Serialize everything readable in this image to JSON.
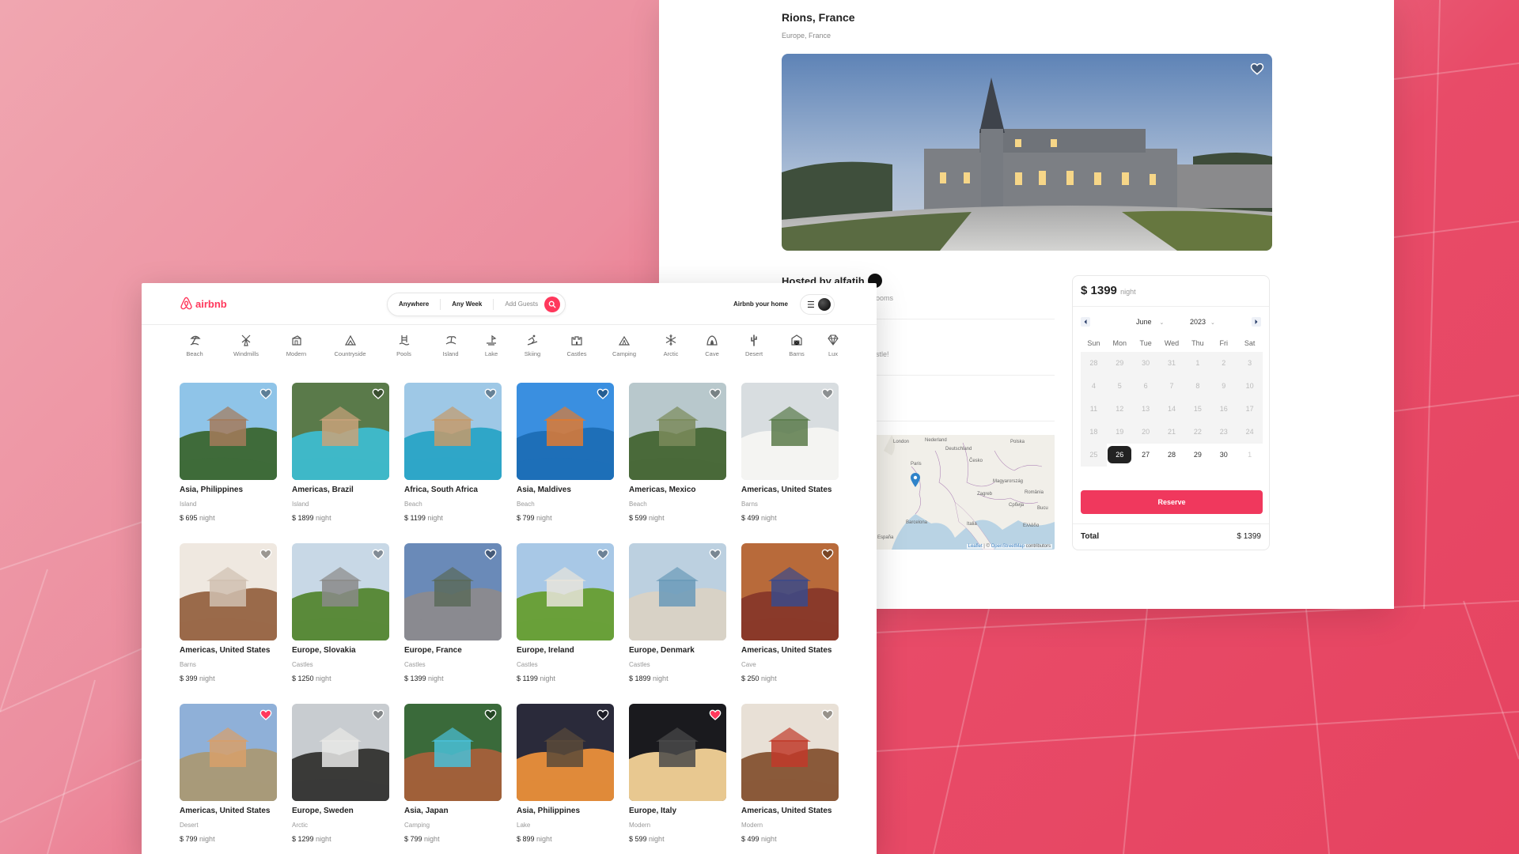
{
  "detail": {
    "title": "Rions, France",
    "subtitle": "Europe, France",
    "hosted_by": "Hosted by alfatih",
    "fragment_rooms": "ooms",
    "fragment_castle": "stle!",
    "map": {
      "labels": [
        "London",
        "Nederland",
        "Deutschland",
        "Paris",
        "Česko",
        "Polska",
        "Magyarország",
        "Zagreb",
        "România",
        "Србија",
        "Barcelona",
        "Italia",
        "Bucu",
        "España",
        "Ελλάδα"
      ],
      "attribution_leaflet": "Leaflet",
      "attribution_sep": " | © ",
      "attribution_osm": "OpenStreetMap",
      "attribution_tail": " contributors"
    },
    "booking": {
      "price": "$ 1399",
      "price_unit": "night",
      "month": "June",
      "year": "2023",
      "weekdays": [
        "Sun",
        "Mon",
        "Tue",
        "Wed",
        "Thu",
        "Fri",
        "Sat"
      ],
      "days": [
        {
          "d": "28",
          "s": "x"
        },
        {
          "d": "29",
          "s": "x"
        },
        {
          "d": "30",
          "s": "x"
        },
        {
          "d": "31",
          "s": "x"
        },
        {
          "d": "1",
          "s": "x"
        },
        {
          "d": "2",
          "s": "x"
        },
        {
          "d": "3",
          "s": "x"
        },
        {
          "d": "4",
          "s": "x"
        },
        {
          "d": "5",
          "s": "x"
        },
        {
          "d": "6",
          "s": "x"
        },
        {
          "d": "7",
          "s": "x"
        },
        {
          "d": "8",
          "s": "x"
        },
        {
          "d": "9",
          "s": "x"
        },
        {
          "d": "10",
          "s": "x"
        },
        {
          "d": "11",
          "s": "x"
        },
        {
          "d": "12",
          "s": "x"
        },
        {
          "d": "13",
          "s": "x"
        },
        {
          "d": "14",
          "s": "x"
        },
        {
          "d": "15",
          "s": "x"
        },
        {
          "d": "16",
          "s": "x"
        },
        {
          "d": "17",
          "s": "x"
        },
        {
          "d": "18",
          "s": "x"
        },
        {
          "d": "19",
          "s": "x"
        },
        {
          "d": "20",
          "s": "x"
        },
        {
          "d": "21",
          "s": "x"
        },
        {
          "d": "22",
          "s": "x"
        },
        {
          "d": "23",
          "s": "x"
        },
        {
          "d": "24",
          "s": "x"
        },
        {
          "d": "25",
          "s": "x"
        },
        {
          "d": "26",
          "s": "sel"
        },
        {
          "d": "27",
          "s": "av"
        },
        {
          "d": "28",
          "s": "av"
        },
        {
          "d": "29",
          "s": "av"
        },
        {
          "d": "30",
          "s": "av"
        },
        {
          "d": "1",
          "s": "w"
        }
      ],
      "reserve_label": "Reserve",
      "total_label": "Total",
      "total_value": "$ 1399"
    }
  },
  "header": {
    "logo_text": "airbnb",
    "search": {
      "anywhere": "Anywhere",
      "week": "Any Week",
      "guests": "Add Guests"
    },
    "host_link": "Airbnb your home"
  },
  "categories": [
    {
      "label": "Beach",
      "icon": "beach-icon"
    },
    {
      "label": "Windmills",
      "icon": "windmill-icon"
    },
    {
      "label": "Modern",
      "icon": "modern-icon"
    },
    {
      "label": "Countryside",
      "icon": "countryside-icon"
    },
    {
      "label": "Pools",
      "icon": "pool-icon"
    },
    {
      "label": "Island",
      "icon": "island-icon"
    },
    {
      "label": "Lake",
      "icon": "lake-icon"
    },
    {
      "label": "Skiing",
      "icon": "skiing-icon"
    },
    {
      "label": "Castles",
      "icon": "castle-icon"
    },
    {
      "label": "Camping",
      "icon": "camping-icon"
    },
    {
      "label": "Arctic",
      "icon": "snowflake-icon"
    },
    {
      "label": "Cave",
      "icon": "cave-icon"
    },
    {
      "label": "Desert",
      "icon": "cactus-icon"
    },
    {
      "label": "Barns",
      "icon": "barn-icon"
    },
    {
      "label": "Lux",
      "icon": "diamond-icon"
    }
  ],
  "listings": [
    {
      "location": "Asia, Philippines",
      "category": "Island",
      "price": "$ 695",
      "unit": "night",
      "fav": false,
      "c1": "#8fc4e8",
      "c2": "#3f6b3a",
      "c3": "#a47a5a"
    },
    {
      "location": "Americas, Brazil",
      "category": "Island",
      "price": "$ 1899",
      "unit": "night",
      "fav": false,
      "c1": "#5a7a4a",
      "c2": "#3fb8c8",
      "c3": "#c9a27a"
    },
    {
      "location": "Africa, South Africa",
      "category": "Beach",
      "price": "$ 1199",
      "unit": "night",
      "fav": false,
      "c1": "#9ec8e6",
      "c2": "#2fa6c8",
      "c3": "#c49a6a"
    },
    {
      "location": "Asia, Maldives",
      "category": "Beach",
      "price": "$ 799",
      "unit": "night",
      "fav": false,
      "c1": "#3a8fe0",
      "c2": "#1e6fb8",
      "c3": "#e07a30"
    },
    {
      "location": "Americas, Mexico",
      "category": "Beach",
      "price": "$ 599",
      "unit": "night",
      "fav": false,
      "c1": "#b8c8cc",
      "c2": "#4a6a3a",
      "c3": "#7a8a5a"
    },
    {
      "location": "Americas, United States",
      "category": "Barns",
      "price": "$ 499",
      "unit": "night",
      "fav": false,
      "c1": "#d8dde0",
      "c2": "#f4f4f2",
      "c3": "#5a7a4a"
    },
    {
      "location": "Americas, United States",
      "category": "Barns",
      "price": "$ 399",
      "unit": "night",
      "fav": false,
      "c1": "#efe8e0",
      "c2": "#9a6a4a",
      "c3": "#d0c0b0"
    },
    {
      "location": "Europe, Slovakia",
      "category": "Castles",
      "price": "$ 1250",
      "unit": "night",
      "fav": false,
      "c1": "#c8d8e6",
      "c2": "#5a8a3a",
      "c3": "#8a8a88"
    },
    {
      "location": "Europe, France",
      "category": "Castles",
      "price": "$ 1399",
      "unit": "night",
      "fav": false,
      "c1": "#6a8ab8",
      "c2": "#8a8a90",
      "c3": "#5a6a5a"
    },
    {
      "location": "Europe, Ireland",
      "category": "Castles",
      "price": "$ 1199",
      "unit": "night",
      "fav": false,
      "c1": "#a8c8e6",
      "c2": "#6aa03a",
      "c3": "#e8e4da"
    },
    {
      "location": "Europe, Denmark",
      "category": "Castles",
      "price": "$ 1899",
      "unit": "night",
      "fav": false,
      "c1": "#bcd0e0",
      "c2": "#d8d2c6",
      "c3": "#6a9ab8"
    },
    {
      "location": "Americas, United States",
      "category": "Cave",
      "price": "$ 250",
      "unit": "night",
      "fav": false,
      "c1": "#b86a3a",
      "c2": "#8a3a2a",
      "c3": "#3a4a8a"
    },
    {
      "location": "Americas, United States",
      "category": "Desert",
      "price": "$ 799",
      "unit": "night",
      "fav": true,
      "c1": "#8fb0d8",
      "c2": "#a89a7a",
      "c3": "#d8a06a"
    },
    {
      "location": "Europe, Sweden",
      "category": "Arctic",
      "price": "$ 1299",
      "unit": "night",
      "fav": false,
      "c1": "#c8ccd0",
      "c2": "#3a3a38",
      "c3": "#e8e8e6"
    },
    {
      "location": "Asia, Japan",
      "category": "Camping",
      "price": "$ 799",
      "unit": "night",
      "fav": false,
      "c1": "#3a6a3a",
      "c2": "#a0603a",
      "c3": "#4ac0d8"
    },
    {
      "location": "Asia, Philippines",
      "category": "Lake",
      "price": "$ 899",
      "unit": "night",
      "fav": false,
      "c1": "#2a2a3a",
      "c2": "#e08a3a",
      "c3": "#5a4a3a"
    },
    {
      "location": "Europe, Italy",
      "category": "Modern",
      "price": "$ 599",
      "unit": "night",
      "fav": true,
      "c1": "#1a1a1e",
      "c2": "#e8c890",
      "c3": "#4a4a4a"
    },
    {
      "location": "Americas, United States",
      "category": "Modern",
      "price": "$ 499",
      "unit": "night",
      "fav": false,
      "c1": "#e8e0d6",
      "c2": "#8a5a3a",
      "c3": "#c03a2a"
    }
  ],
  "colors": {
    "brand": "#ff385c",
    "reserve": "#f0385d",
    "fav_heart": "#ff385c"
  }
}
